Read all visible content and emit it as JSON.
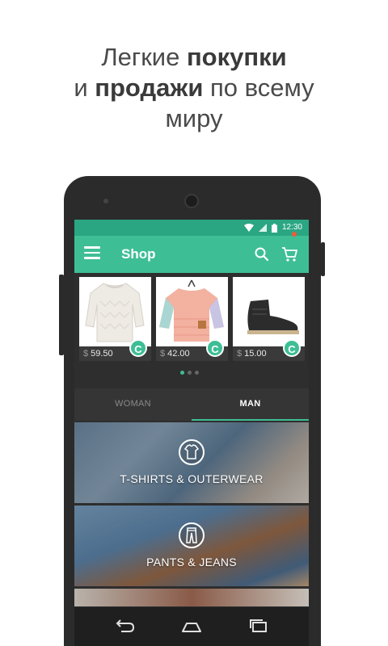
{
  "headline": {
    "line1_regular": "Легкие ",
    "line1_bold": "покупки",
    "line2_regular1": "и ",
    "line2_bold": "продажи",
    "line2_regular2": " по всему",
    "line3": "миру"
  },
  "statusbar": {
    "time": "12:30",
    "icons": [
      "wifi-icon",
      "signal-icon",
      "battery-icon"
    ]
  },
  "appbar": {
    "title": "Shop",
    "icons": [
      "menu-icon",
      "search-icon",
      "cart-icon"
    ]
  },
  "products": [
    {
      "currency": "$",
      "price": "59.50",
      "item": "white knit sweater",
      "badge": "C"
    },
    {
      "currency": "$",
      "price": "42.00",
      "item": "pink sweatshirt",
      "badge": "C"
    },
    {
      "currency": "$",
      "price": "15.00",
      "item": "black ankle boot",
      "badge": "C"
    }
  ],
  "carousel": {
    "pages": 3,
    "active": 0
  },
  "tabs": [
    {
      "label": "WOMAN",
      "active": false
    },
    {
      "label": "MAN",
      "active": true
    }
  ],
  "categories": [
    {
      "label": "T-SHIRTS & OUTERWEAR",
      "icon": "tshirt-icon"
    },
    {
      "label": "PANTS & JEANS",
      "icon": "pants-icon"
    }
  ],
  "colors": {
    "accent": "#3ebe95",
    "statusbar": "#2aa682",
    "phone_body": "#2b2b2b"
  }
}
